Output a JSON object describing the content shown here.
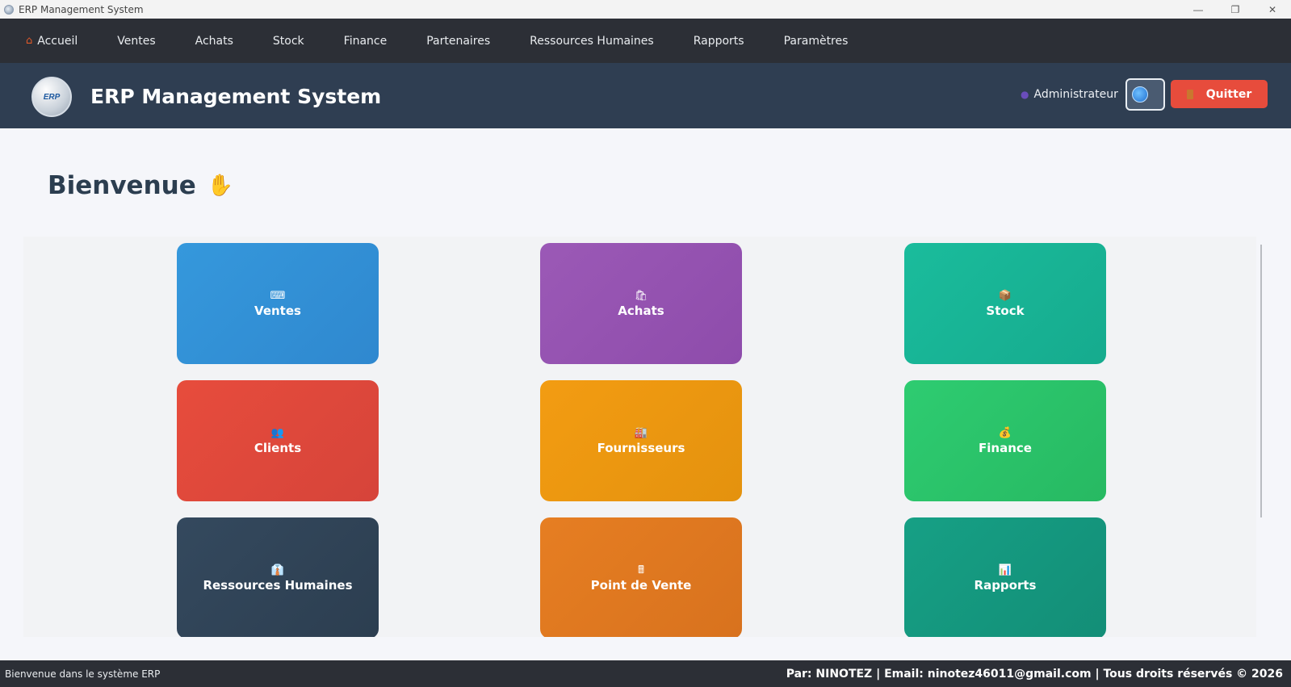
{
  "window": {
    "title": "ERP Management System",
    "controls": {
      "minimize": "—",
      "maximize": "❐",
      "close": "✕"
    }
  },
  "menubar": {
    "items": [
      {
        "label": "Accueil",
        "icon": "home-icon"
      },
      {
        "label": "Ventes"
      },
      {
        "label": "Achats"
      },
      {
        "label": "Stock"
      },
      {
        "label": "Finance"
      },
      {
        "label": "Partenaires"
      },
      {
        "label": "Ressources Humaines"
      },
      {
        "label": "Rapports"
      },
      {
        "label": "Paramètres"
      }
    ]
  },
  "header": {
    "logo_text": "ERP",
    "title": "ERP Management System",
    "user": "Administrateur",
    "quit_label": "Quitter"
  },
  "main": {
    "welcome": "Bienvenue",
    "tiles": [
      {
        "label": "Ventes",
        "icon": "keyboard-icon",
        "glyph": "⌨",
        "color": "#3598dc"
      },
      {
        "label": "Achats",
        "icon": "shopping-bag-icon",
        "glyph": "🛍",
        "color": "#9b59b6"
      },
      {
        "label": "Stock",
        "icon": "package-icon",
        "glyph": "📦",
        "color": "#1abc9c"
      },
      {
        "label": "Clients",
        "icon": "users-icon",
        "glyph": "👥",
        "color": "#e74c3c"
      },
      {
        "label": "Fournisseurs",
        "icon": "factory-icon",
        "glyph": "🏭",
        "color": "#f39c12"
      },
      {
        "label": "Finance",
        "icon": "money-bag-icon",
        "glyph": "💰",
        "color": "#2ecc71"
      },
      {
        "label": "Ressources Humaines",
        "icon": "suit-icon",
        "glyph": "👔",
        "color": "#34495e"
      },
      {
        "label": "Point de Vente",
        "icon": "register-icon",
        "glyph": "🖩",
        "color": "#e67e22"
      },
      {
        "label": "Rapports",
        "icon": "bar-chart-icon",
        "glyph": "📊",
        "color": "#16a085"
      }
    ]
  },
  "statusbar": {
    "left": "Bienvenue dans le système ERP",
    "right": "Par: NINOTEZ | Email: ninotez46011@gmail.com | Tous droits réservés © 2026"
  }
}
